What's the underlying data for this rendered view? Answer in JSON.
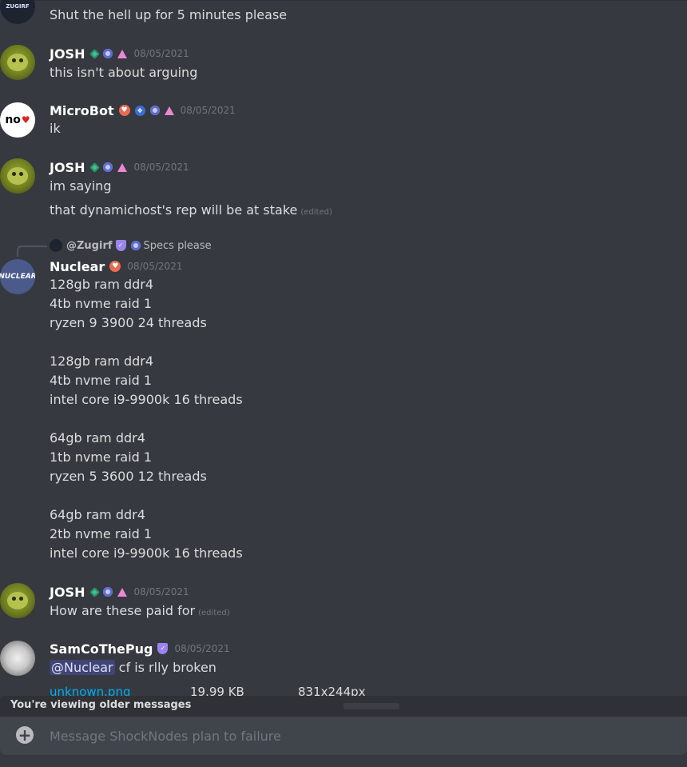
{
  "messages": [
    {
      "lines": [
        "Shut the hell up for 5 minutes please"
      ],
      "avatar_text": "ZUGIRF"
    },
    {
      "username": "JOSH",
      "timestamp": "08/05/2021",
      "lines": [
        "this isn't about arguing"
      ]
    },
    {
      "username": "MicroBot",
      "timestamp": "08/05/2021",
      "avatar_text": "no",
      "lines": [
        "ik"
      ]
    },
    {
      "username": "JOSH",
      "timestamp": "08/05/2021",
      "lines": [
        "im saying",
        "that dynamichost's rep will be at stake"
      ],
      "edited_label": "(edited)"
    },
    {
      "reply": {
        "username": "@Zugirf",
        "text": "Specs please"
      },
      "username": "Nuclear",
      "timestamp": "08/05/2021",
      "avatar_text": "NUCLEAR",
      "lines": [
        "128gb ram ddr4",
        "4tb nvme raid 1",
        "ryzen 9 3900 24 threads",
        "128gb ram ddr4",
        "4tb nvme raid 1",
        "intel core i9-9900k 16 threads",
        "64gb ram ddr4",
        "1tb nvme raid 1",
        "ryzen 5 3600 12 threads",
        "64gb ram ddr4",
        "2tb nvme raid 1",
        "intel core i9-9900k 16 threads"
      ]
    },
    {
      "username": "JOSH",
      "timestamp": "08/05/2021",
      "lines": [
        "How are these paid for"
      ],
      "edited_label": "(edited)"
    },
    {
      "username": "SamCoThePug",
      "timestamp": "08/05/2021",
      "mention": "@Nuclear",
      "lines": [
        "cf is rlly broken"
      ],
      "attachment": {
        "name": "unknown.png",
        "size": "19.99 KB",
        "dims": "831x244px"
      }
    }
  ],
  "older_notice": "You're viewing older messages",
  "composer": {
    "placeholder": "Message ShockNodes plan to failure"
  },
  "icons": {
    "composer": "plus-circle-icon",
    "badges": [
      "hypesquad-diamond-icon",
      "server-boost-icon",
      "early-supporter-triangle-icon",
      "heart-badge-icon",
      "blue-badge-icon",
      "nitro-shield-icon"
    ]
  },
  "colors": {
    "background": "#36393f",
    "username": "#ffffff",
    "text": "#dcddde",
    "timestamp": "#72767d",
    "link": "#00aff4",
    "mention_bg": "#4c5696",
    "composer_bg": "#40444b"
  }
}
